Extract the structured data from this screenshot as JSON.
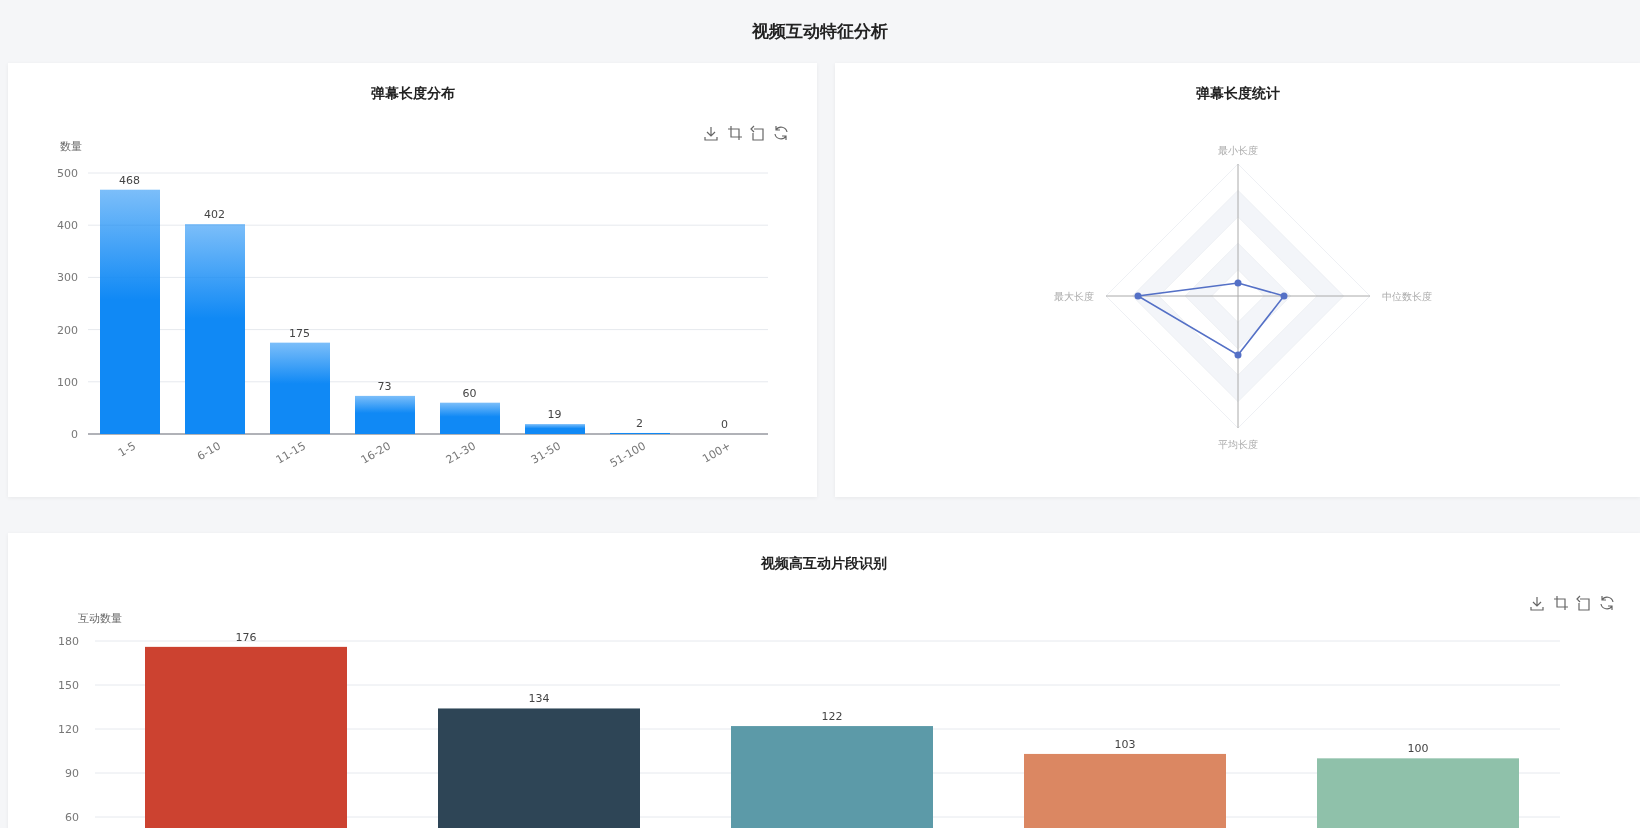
{
  "page_title": "视频互动特征分析",
  "length_distribution": {
    "title": "弹幕长度分布",
    "chart_data": {
      "type": "bar",
      "ylabel": "数量",
      "categories": [
        "1-5",
        "6-10",
        "11-15",
        "16-20",
        "21-30",
        "31-50",
        "51-100",
        "100+"
      ],
      "series": [
        {
          "color": "#1089f5",
          "values": [
            468,
            402,
            175,
            73,
            60,
            19,
            2,
            0
          ]
        }
      ],
      "ylim": [
        0,
        500
      ],
      "yticks": [
        0,
        100,
        200,
        300,
        400,
        500
      ],
      "grid": true,
      "data_labels": true
    }
  },
  "length_stats": {
    "title": "弹幕长度统计",
    "axes": [
      "最小长度",
      "中位数长度",
      "平均长度",
      "最大长度"
    ]
  },
  "high_interaction": {
    "title": "视频高互动片段识别",
    "chart_data": {
      "type": "bar",
      "ylabel": "互动数量",
      "series": [
        {
          "values": [
            176,
            134,
            122,
            103,
            100
          ]
        }
      ],
      "colors": [
        "#cc4230",
        "#2e4556",
        "#5c9aa8",
        "#db8762",
        "#8fc1aa"
      ],
      "ylim": [
        0,
        180
      ],
      "yticks": [
        60,
        90,
        120,
        150,
        180
      ],
      "grid": true,
      "data_labels": true
    }
  }
}
